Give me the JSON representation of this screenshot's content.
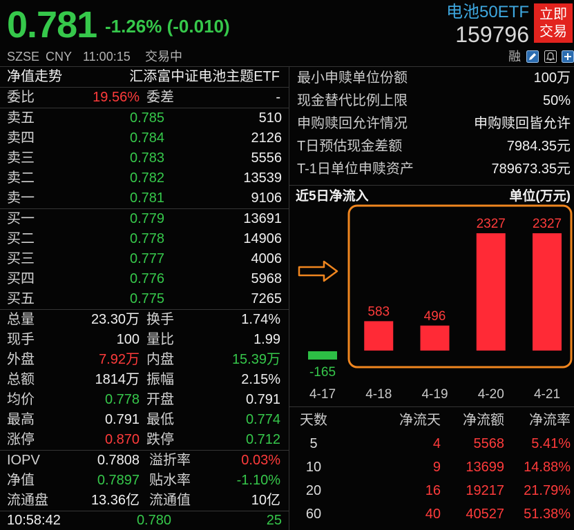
{
  "colors": {
    "up": "#ff3b3b",
    "down": "#36c84b",
    "accent": "#3ea7df",
    "trade": "#e2231e",
    "bar_up": "#ff2a36",
    "bar_down": "#2dbf45",
    "highlight": "#f0861f"
  },
  "header": {
    "price": "0.781",
    "change": "-1.26% (-0.010)",
    "name": "电池50ETF",
    "code": "159796",
    "trade_line1": "立即",
    "trade_line2": "交易",
    "exchange": "SZSE",
    "currency": "CNY",
    "time": "11:00:15",
    "status": "交易中"
  },
  "toolbar": {
    "margin_label": "融",
    "icons": [
      "edit-icon",
      "alert-icon",
      "add-icon"
    ]
  },
  "fund": {
    "title": "净值走势",
    "name": "汇添富中证电池主题ETF"
  },
  "ratio": {
    "weibi_label": "委比",
    "weibi": "19.56%",
    "weicha_label": "委差",
    "weicha": "-"
  },
  "asks": [
    {
      "label": "卖五",
      "price": "0.785",
      "volume": "510"
    },
    {
      "label": "卖四",
      "price": "0.784",
      "volume": "2126"
    },
    {
      "label": "卖三",
      "price": "0.783",
      "volume": "5556"
    },
    {
      "label": "卖二",
      "price": "0.782",
      "volume": "13539"
    },
    {
      "label": "卖一",
      "price": "0.781",
      "volume": "9106"
    }
  ],
  "bids": [
    {
      "label": "买一",
      "price": "0.779",
      "volume": "13691"
    },
    {
      "label": "买二",
      "price": "0.778",
      "volume": "14906"
    },
    {
      "label": "买三",
      "price": "0.777",
      "volume": "4006"
    },
    {
      "label": "买四",
      "price": "0.776",
      "volume": "5968"
    },
    {
      "label": "买五",
      "price": "0.775",
      "volume": "7265"
    }
  ],
  "stats": [
    {
      "l1": "总量",
      "v1": "23.30万",
      "l2": "换手",
      "v2": "1.74%"
    },
    {
      "l1": "现手",
      "v1": "100",
      "l2": "量比",
      "v2": "1.99"
    },
    {
      "l1": "外盘",
      "v1": "7.92万",
      "l2": "内盘",
      "v2": "15.39万"
    },
    {
      "l1": "总额",
      "v1": "1814万",
      "l2": "振幅",
      "v2": "2.15%"
    },
    {
      "l1": "均价",
      "v1": "0.778",
      "l2": "开盘",
      "v2": "0.791"
    },
    {
      "l1": "最高",
      "v1": "0.791",
      "l2": "最低",
      "v2": "0.774"
    },
    {
      "l1": "涨停",
      "v1": "0.870",
      "l2": "跌停",
      "v2": "0.712"
    }
  ],
  "iopv": [
    {
      "l1": "IOPV",
      "v1": "0.7808",
      "l2": "溢折率",
      "v2": "0.03%"
    },
    {
      "l1": "净值",
      "v1": "0.7897",
      "l2": "贴水率",
      "v2": "-1.10%"
    },
    {
      "l1": "流通盘",
      "v1": "13.36亿",
      "l2": "流通值",
      "v2": "10亿"
    }
  ],
  "tick": {
    "time": "10:58:42",
    "price": "0.780",
    "volume": "25"
  },
  "etf_info": [
    {
      "label": "最小申赎单位份额",
      "value": "100万"
    },
    {
      "label": "现金替代比例上限",
      "value": "50%"
    },
    {
      "label": "申购赎回允许情况",
      "value": "申购赎回皆允许"
    },
    {
      "label": "T日预估现金差额",
      "value": "7984.35元"
    },
    {
      "label": "T-1日单位申赎资产",
      "value": "789673.35元"
    }
  ],
  "chart_data": {
    "type": "bar",
    "title": "近5日净流入",
    "unit": "单位(万元)",
    "categories": [
      "4-17",
      "4-18",
      "4-19",
      "4-20",
      "4-21"
    ],
    "values": [
      -165,
      583,
      496,
      2327,
      2327
    ]
  },
  "flow_table": {
    "headers": [
      "天数",
      "净流天",
      "净流额",
      "净流率"
    ],
    "rows": [
      [
        "5",
        "4",
        "5568",
        "5.41%"
      ],
      [
        "10",
        "9",
        "13699",
        "14.88%"
      ],
      [
        "20",
        "16",
        "19217",
        "21.79%"
      ],
      [
        "60",
        "40",
        "40527",
        "51.38%"
      ]
    ]
  }
}
